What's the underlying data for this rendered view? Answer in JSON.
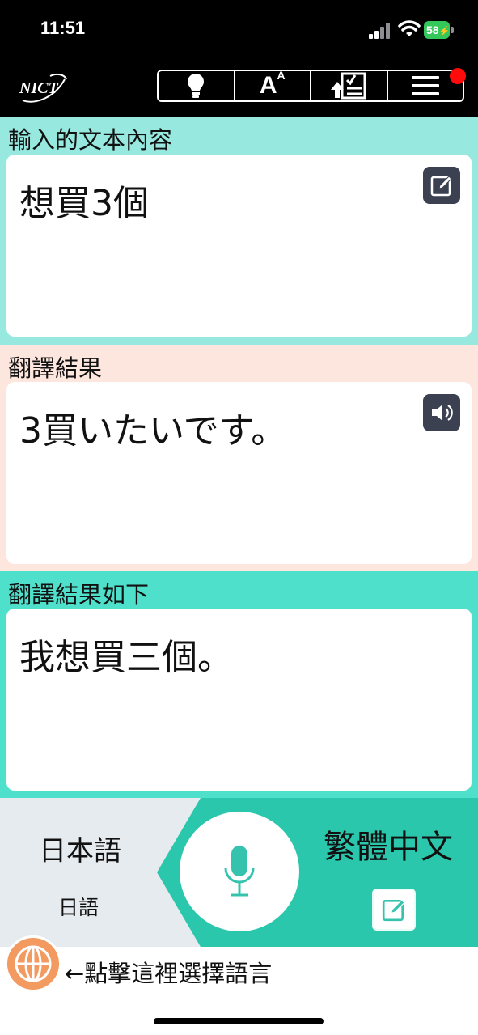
{
  "status_bar": {
    "time": "11:51",
    "battery": "58"
  },
  "toolbar": {
    "logo": "NICT",
    "font_size_label": "A",
    "font_size_sup": "A"
  },
  "input_section": {
    "label": "輸入的文本內容",
    "text": "想買3個",
    "background": "#97e8df"
  },
  "translation_section": {
    "label": "翻譯結果",
    "text": "3買いたいです。",
    "background": "#fde6dd"
  },
  "back_translation_section": {
    "label": "翻譯結果如下",
    "text": "我想買三個。",
    "background": "#4fe0cc"
  },
  "language_bar": {
    "source_language": "日本語",
    "source_language_sub": "日語",
    "target_language": "繁體中文"
  },
  "hint": {
    "text": "←點擊這裡選擇語言"
  },
  "colors": {
    "accent": "#2bc7ad",
    "globe": "#f29a60",
    "notification": "#ff0b0b"
  }
}
